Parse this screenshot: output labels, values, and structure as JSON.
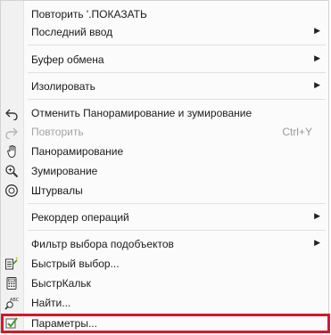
{
  "menu": {
    "items": [
      {
        "label": "Повторить '.ПОКАЗАТЬ"
      },
      {
        "label": "Последний ввод"
      },
      {
        "label": "Буфер обмена"
      },
      {
        "label": "Изолировать"
      },
      {
        "label": "Отменить Панорамирование и зумирование",
        "icon": "undo-icon"
      },
      {
        "label": "Повторить",
        "icon": "redo-icon",
        "shortcut": "Ctrl+Y"
      },
      {
        "label": "Панорамирование",
        "icon": "pan-hand-icon"
      },
      {
        "label": "Зумирование",
        "icon": "zoom-magnifier-icon"
      },
      {
        "label": "Штурвалы",
        "icon": "steering-wheel-icon"
      },
      {
        "label": "Рекордер операций"
      },
      {
        "label": "Фильтр выбора подобъектов"
      },
      {
        "label": "Быстрый выбор...",
        "icon": "quick-select-icon"
      },
      {
        "label": "БыстрКальк",
        "icon": "calculator-icon"
      },
      {
        "label": "Найти...",
        "icon": "find-abc-icon"
      },
      {
        "label": "Параметры...",
        "icon": "options-checkmark-icon"
      }
    ]
  },
  "colors": {
    "highlight_border": "#d3192c",
    "gutter": "#f1f1f1",
    "background": "#fbfbfb"
  }
}
